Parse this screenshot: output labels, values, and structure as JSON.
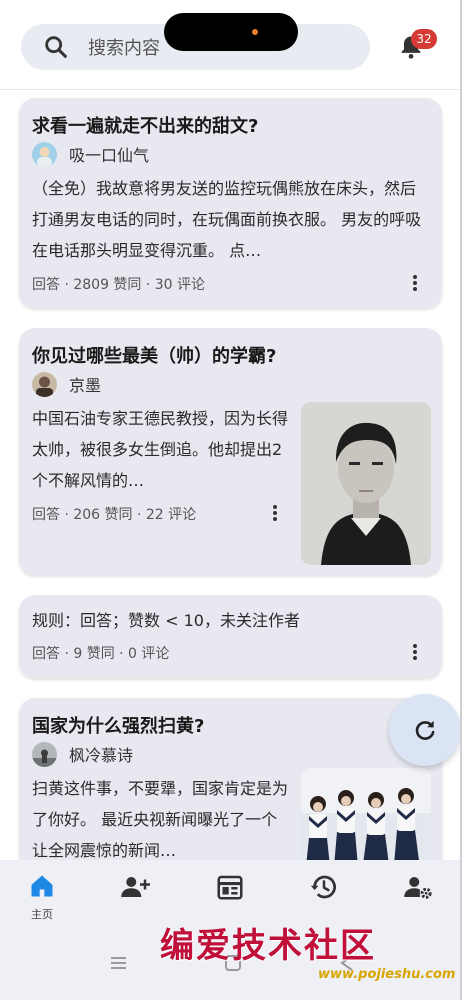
{
  "header": {
    "search_placeholder": "搜索内容",
    "notification_count": "32"
  },
  "feed": [
    {
      "title": "求看一遍就走不出来的甜文?",
      "author": "吸一口仙气",
      "excerpt": "（全免）我故意将男友送的监控玩偶熊放在床头，然后打通男友电话的同时，在玩偶面前换衣服。 男友的呼吸在电话那头明显变得沉重。 点…",
      "meta": "回答 · 2809 赞同 · 30 评论"
    },
    {
      "title": "你见过哪些最美（帅）的学霸?",
      "author": "京墨",
      "excerpt": "中国石油专家王德民教授，因为长得太帅，被很多女生倒追。他却提出2个不解风情的…",
      "meta": "回答 · 206 赞同 · 22 评论"
    },
    {
      "excerpt": "规则：回答；赞数 < 10，未关注作者",
      "meta": "回答 · 9 赞同 · 0 评论"
    },
    {
      "title": "国家为什么强烈扫黄?",
      "author": "枫冷慕诗",
      "excerpt": "扫黄这件事，不要犟，国家肯定是为了你好。 最近央视新闻曝光了一个让全网震惊的新闻…"
    }
  ],
  "bottom_nav": {
    "items": [
      {
        "icon": "home-icon",
        "label": "主页",
        "active": true
      },
      {
        "icon": "add-person-icon"
      },
      {
        "icon": "calendar-icon"
      },
      {
        "icon": "history-icon"
      },
      {
        "icon": "user-settings-icon"
      }
    ]
  },
  "watermark": {
    "text": "编爱技术社区",
    "url": "www.pojieshu.com"
  },
  "colors": {
    "accent": "#1e88e5",
    "card_bg": "#e8e9f0",
    "badge": "#d43b34",
    "fab_bg": "#dbe4f4"
  }
}
